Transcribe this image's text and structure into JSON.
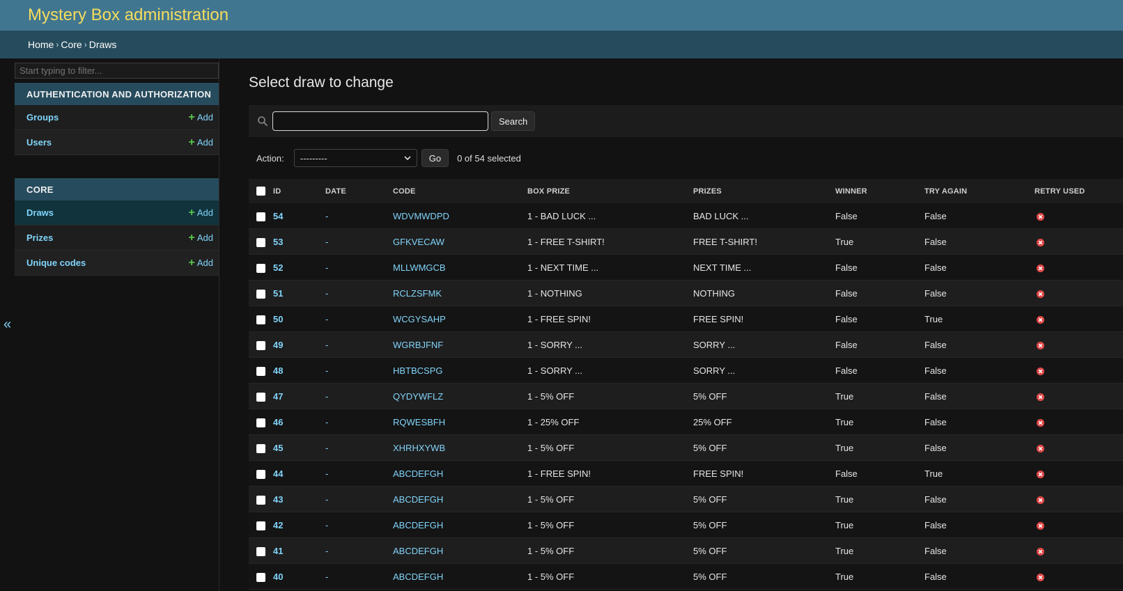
{
  "header": {
    "title": "Mystery Box administration"
  },
  "breadcrumbs": {
    "home": "Home",
    "app": "Core",
    "current": "Draws",
    "separator": "›"
  },
  "sidebar": {
    "toggle": "«",
    "filter_placeholder": "Start typing to filter...",
    "modules": [
      {
        "caption": "AUTHENTICATION AND AUTHORIZATION",
        "items": [
          {
            "name": "Groups",
            "add": "Add"
          },
          {
            "name": "Users",
            "add": "Add"
          }
        ]
      },
      {
        "caption": "CORE",
        "items": [
          {
            "name": "Draws",
            "add": "Add"
          },
          {
            "name": "Prizes",
            "add": "Add"
          },
          {
            "name": "Unique codes",
            "add": "Add"
          }
        ]
      }
    ]
  },
  "main": {
    "title": "Select draw to change",
    "search_button": "Search",
    "search_value": "",
    "action_label": "Action:",
    "action_selected": "---------",
    "go_label": "Go",
    "counter": "0 of 54 selected"
  },
  "table": {
    "headers": {
      "id": "ID",
      "date": "DATE",
      "code": "CODE",
      "box_prize": "BOX PRIZE",
      "prizes": "PRIZES",
      "winner": "WINNER",
      "try_again": "TRY AGAIN",
      "retry_used": "RETRY USED"
    },
    "rows": [
      {
        "id": "54",
        "date": "-",
        "code": "WDVMWDPD",
        "box_prize": "1 - BAD LUCK ...",
        "prizes": "BAD LUCK ...",
        "winner": "False",
        "try_again": "False"
      },
      {
        "id": "53",
        "date": "-",
        "code": "GFKVECAW",
        "box_prize": "1 - FREE T-SHIRT!",
        "prizes": "FREE T-SHIRT!",
        "winner": "True",
        "try_again": "False"
      },
      {
        "id": "52",
        "date": "-",
        "code": "MLLWMGCB",
        "box_prize": "1 - NEXT TIME ...",
        "prizes": "NEXT TIME ...",
        "winner": "False",
        "try_again": "False"
      },
      {
        "id": "51",
        "date": "-",
        "code": "RCLZSFMK",
        "box_prize": "1 - NOTHING",
        "prizes": "NOTHING",
        "winner": "False",
        "try_again": "False"
      },
      {
        "id": "50",
        "date": "-",
        "code": "WCGYSAHP",
        "box_prize": "1 - FREE SPIN!",
        "prizes": "FREE SPIN!",
        "winner": "False",
        "try_again": "True"
      },
      {
        "id": "49",
        "date": "-",
        "code": "WGRBJFNF",
        "box_prize": "1 - SORRY ...",
        "prizes": "SORRY ...",
        "winner": "False",
        "try_again": "False"
      },
      {
        "id": "48",
        "date": "-",
        "code": "HBTBCSPG",
        "box_prize": "1 - SORRY ...",
        "prizes": "SORRY ...",
        "winner": "False",
        "try_again": "False"
      },
      {
        "id": "47",
        "date": "-",
        "code": "QYDYWFLZ",
        "box_prize": "1 - 5% OFF",
        "prizes": "5% OFF",
        "winner": "True",
        "try_again": "False"
      },
      {
        "id": "46",
        "date": "-",
        "code": "RQWESBFH",
        "box_prize": "1 - 25% OFF",
        "prizes": "25% OFF",
        "winner": "True",
        "try_again": "False"
      },
      {
        "id": "45",
        "date": "-",
        "code": "XHRHXYWB",
        "box_prize": "1 - 5% OFF",
        "prizes": "5% OFF",
        "winner": "True",
        "try_again": "False"
      },
      {
        "id": "44",
        "date": "-",
        "code": "ABCDEFGH",
        "box_prize": "1 - FREE SPIN!",
        "prizes": "FREE SPIN!",
        "winner": "False",
        "try_again": "True"
      },
      {
        "id": "43",
        "date": "-",
        "code": "ABCDEFGH",
        "box_prize": "1 - 5% OFF",
        "prizes": "5% OFF",
        "winner": "True",
        "try_again": "False"
      },
      {
        "id": "42",
        "date": "-",
        "code": "ABCDEFGH",
        "box_prize": "1 - 5% OFF",
        "prizes": "5% OFF",
        "winner": "True",
        "try_again": "False"
      },
      {
        "id": "41",
        "date": "-",
        "code": "ABCDEFGH",
        "box_prize": "1 - 5% OFF",
        "prizes": "5% OFF",
        "winner": "True",
        "try_again": "False"
      },
      {
        "id": "40",
        "date": "-",
        "code": "ABCDEFGH",
        "box_prize": "1 - 5% OFF",
        "prizes": "5% OFF",
        "winner": "True",
        "try_again": "False"
      }
    ]
  },
  "icons": {
    "search": "search-icon",
    "retry_used": "x-circle-icon",
    "add": "plus-icon"
  },
  "colors": {
    "header": "#417690",
    "breadcrumbs": "#264b5d",
    "branding": "#f5dd5d",
    "link": "#81d4fa",
    "add_plus": "#5ac44e",
    "retry_false": "#dd4646"
  }
}
